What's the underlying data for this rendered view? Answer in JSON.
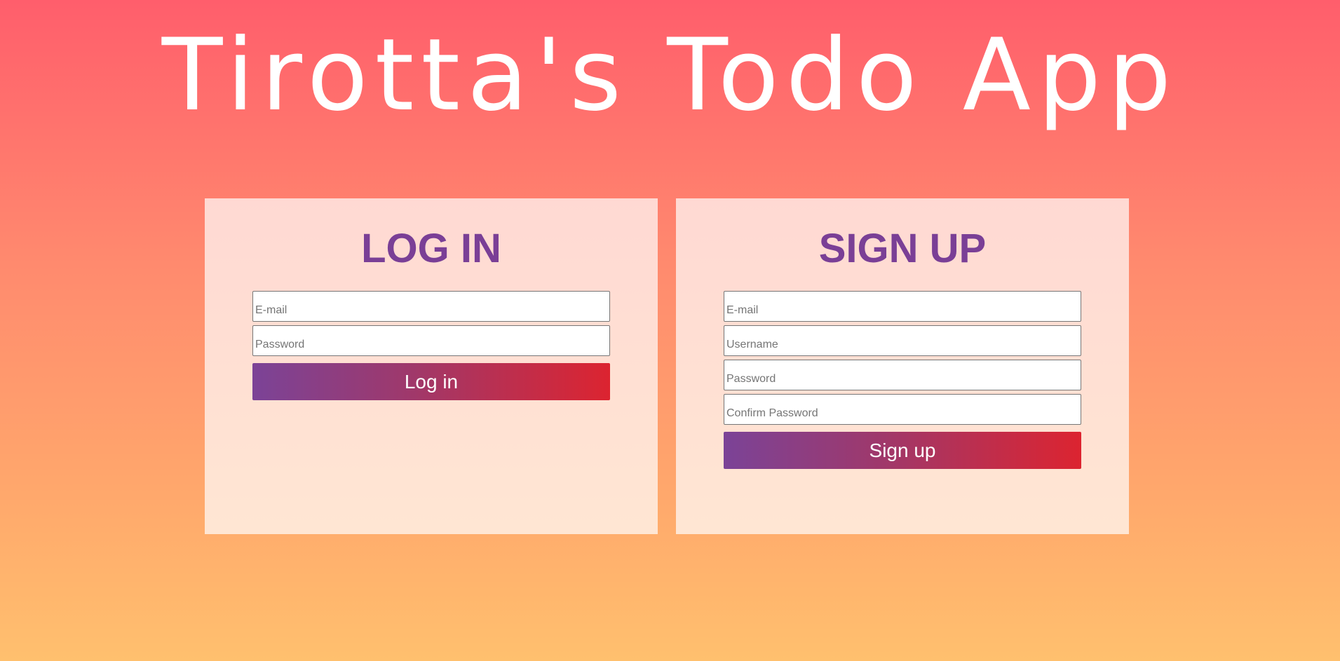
{
  "app": {
    "title": "Tirotta's Todo App"
  },
  "login": {
    "heading": "LOG IN",
    "email_placeholder": "E-mail",
    "password_placeholder": "Password",
    "button_label": "Log in"
  },
  "signup": {
    "heading": "SIGN UP",
    "email_placeholder": "E-mail",
    "username_placeholder": "Username",
    "password_placeholder": "Password",
    "confirm_password_placeholder": "Confirm Password",
    "button_label": "Sign up"
  },
  "colors": {
    "heading": "#7a3f96",
    "button_start": "#7b4397",
    "button_end": "#dc2430",
    "background_top": "#ff5e6c",
    "background_bottom": "#ffc06e"
  }
}
